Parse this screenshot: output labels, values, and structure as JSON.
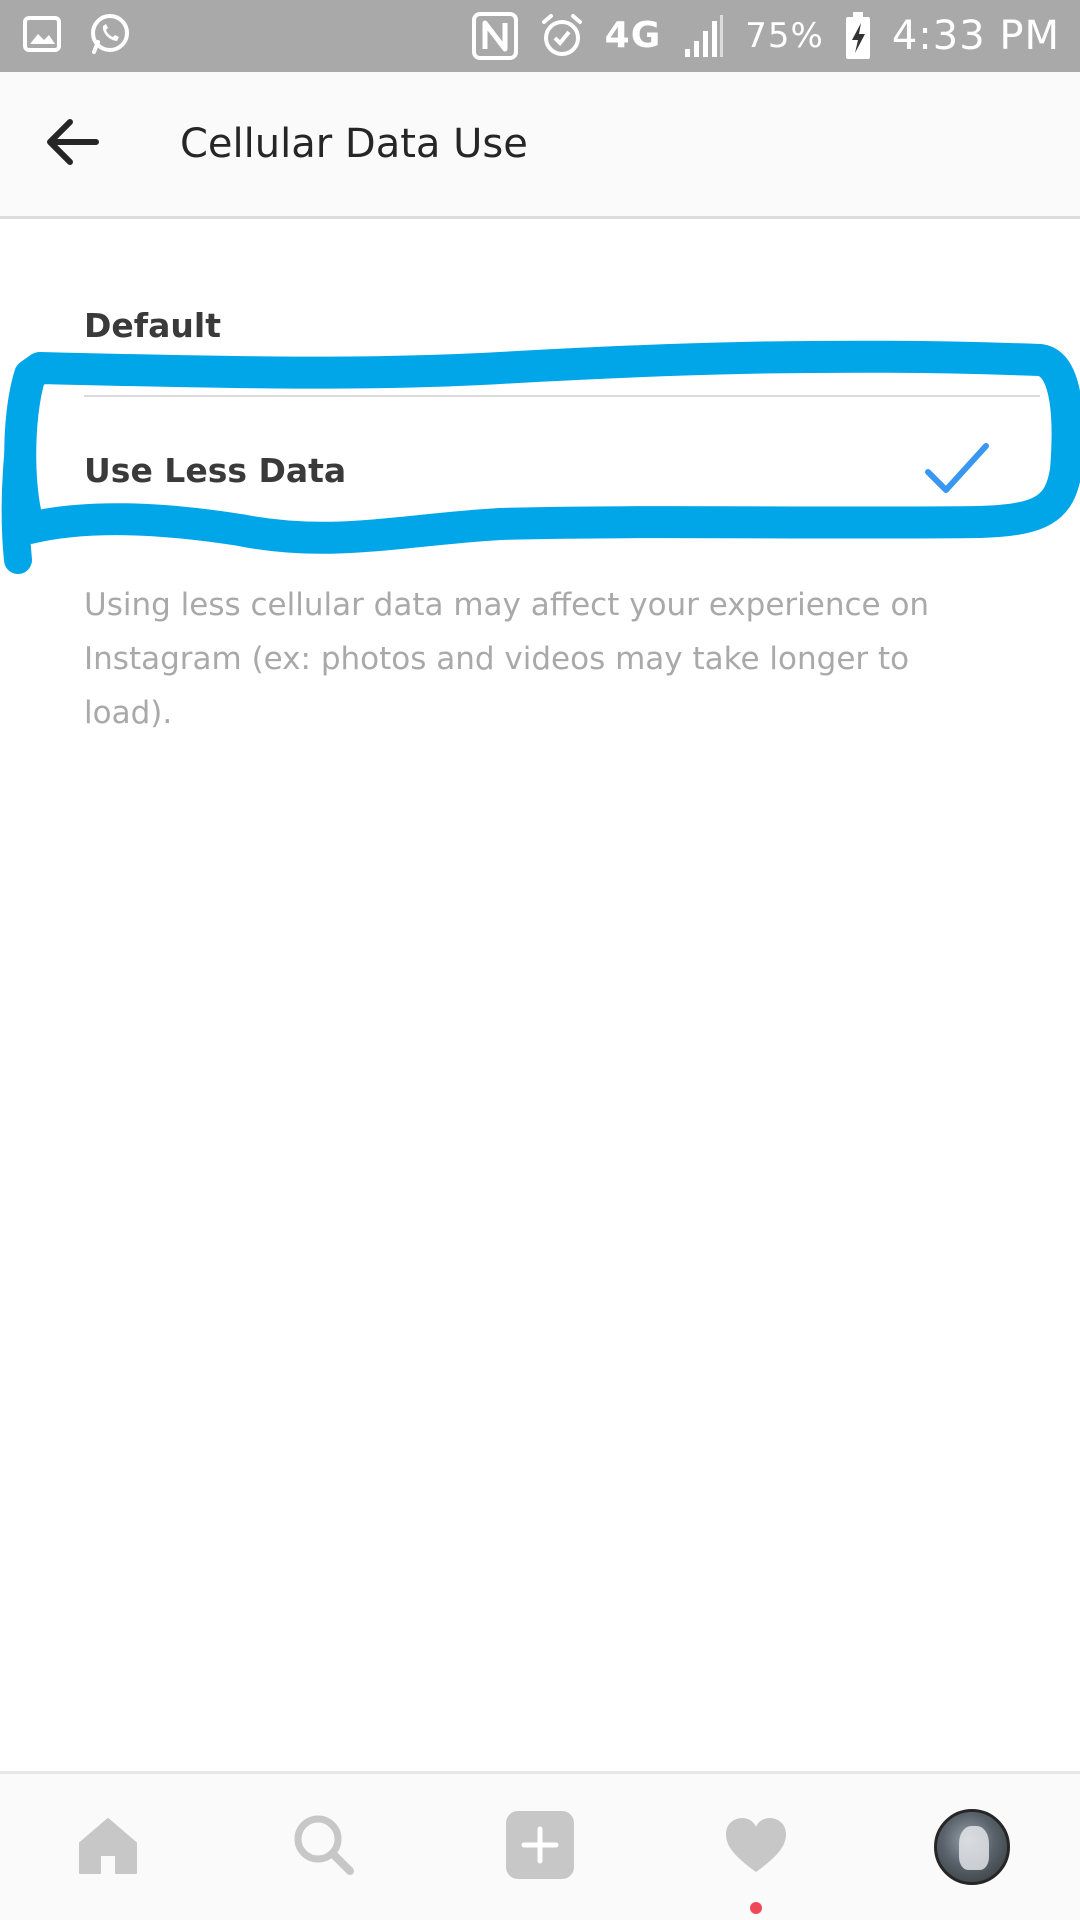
{
  "status_bar": {
    "battery": "75%",
    "time": "4:33 PM",
    "network": "4G",
    "icons": [
      "image-icon",
      "whatsapp-icon",
      "nfc-icon",
      "alarm-icon",
      "signal-icon",
      "battery-charging-icon"
    ]
  },
  "header": {
    "title": "Cellular Data Use",
    "back_icon": "arrow-left-icon"
  },
  "options": {
    "default_label": "Default",
    "less_label": "Use Less Data",
    "selected": "Use Less Data",
    "check_icon": "checkmark-icon"
  },
  "description": "Using less cellular data may affect your experience on Instagram (ex: photos and videos may take longer to load).",
  "bottom_nav": {
    "items": [
      "home-icon",
      "search-icon",
      "add-post-icon",
      "activity-heart-icon",
      "profile-avatar"
    ],
    "activity_dot": true
  },
  "colors": {
    "status_bar_bg": "#a9a9a9",
    "check": "#3897f0",
    "highlight": "#00a6e8",
    "notification_dot": "#ed4956",
    "nav_icon": "#c7c7c7"
  }
}
